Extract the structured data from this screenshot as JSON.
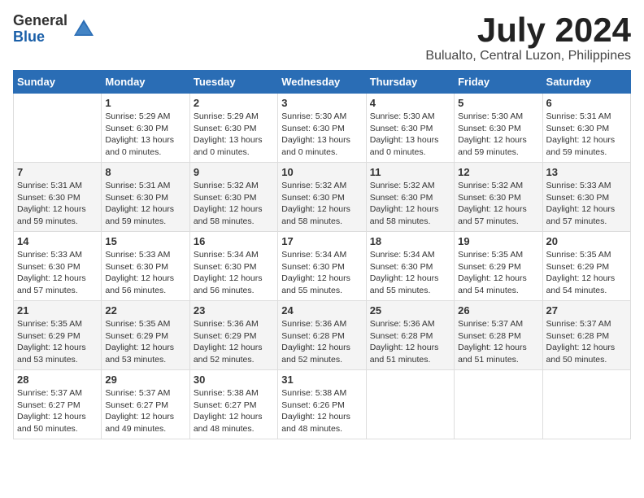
{
  "logo": {
    "general": "General",
    "blue": "Blue"
  },
  "title": "July 2024",
  "location": "Bulualto, Central Luzon, Philippines",
  "headers": [
    "Sunday",
    "Monday",
    "Tuesday",
    "Wednesday",
    "Thursday",
    "Friday",
    "Saturday"
  ],
  "weeks": [
    [
      {
        "day": "",
        "info": ""
      },
      {
        "day": "1",
        "info": "Sunrise: 5:29 AM\nSunset: 6:30 PM\nDaylight: 13 hours\nand 0 minutes."
      },
      {
        "day": "2",
        "info": "Sunrise: 5:29 AM\nSunset: 6:30 PM\nDaylight: 13 hours\nand 0 minutes."
      },
      {
        "day": "3",
        "info": "Sunrise: 5:30 AM\nSunset: 6:30 PM\nDaylight: 13 hours\nand 0 minutes."
      },
      {
        "day": "4",
        "info": "Sunrise: 5:30 AM\nSunset: 6:30 PM\nDaylight: 13 hours\nand 0 minutes."
      },
      {
        "day": "5",
        "info": "Sunrise: 5:30 AM\nSunset: 6:30 PM\nDaylight: 12 hours\nand 59 minutes."
      },
      {
        "day": "6",
        "info": "Sunrise: 5:31 AM\nSunset: 6:30 PM\nDaylight: 12 hours\nand 59 minutes."
      }
    ],
    [
      {
        "day": "7",
        "info": "Sunrise: 5:31 AM\nSunset: 6:30 PM\nDaylight: 12 hours\nand 59 minutes."
      },
      {
        "day": "8",
        "info": "Sunrise: 5:31 AM\nSunset: 6:30 PM\nDaylight: 12 hours\nand 59 minutes."
      },
      {
        "day": "9",
        "info": "Sunrise: 5:32 AM\nSunset: 6:30 PM\nDaylight: 12 hours\nand 58 minutes."
      },
      {
        "day": "10",
        "info": "Sunrise: 5:32 AM\nSunset: 6:30 PM\nDaylight: 12 hours\nand 58 minutes."
      },
      {
        "day": "11",
        "info": "Sunrise: 5:32 AM\nSunset: 6:30 PM\nDaylight: 12 hours\nand 58 minutes."
      },
      {
        "day": "12",
        "info": "Sunrise: 5:32 AM\nSunset: 6:30 PM\nDaylight: 12 hours\nand 57 minutes."
      },
      {
        "day": "13",
        "info": "Sunrise: 5:33 AM\nSunset: 6:30 PM\nDaylight: 12 hours\nand 57 minutes."
      }
    ],
    [
      {
        "day": "14",
        "info": "Sunrise: 5:33 AM\nSunset: 6:30 PM\nDaylight: 12 hours\nand 57 minutes."
      },
      {
        "day": "15",
        "info": "Sunrise: 5:33 AM\nSunset: 6:30 PM\nDaylight: 12 hours\nand 56 minutes."
      },
      {
        "day": "16",
        "info": "Sunrise: 5:34 AM\nSunset: 6:30 PM\nDaylight: 12 hours\nand 56 minutes."
      },
      {
        "day": "17",
        "info": "Sunrise: 5:34 AM\nSunset: 6:30 PM\nDaylight: 12 hours\nand 55 minutes."
      },
      {
        "day": "18",
        "info": "Sunrise: 5:34 AM\nSunset: 6:30 PM\nDaylight: 12 hours\nand 55 minutes."
      },
      {
        "day": "19",
        "info": "Sunrise: 5:35 AM\nSunset: 6:29 PM\nDaylight: 12 hours\nand 54 minutes."
      },
      {
        "day": "20",
        "info": "Sunrise: 5:35 AM\nSunset: 6:29 PM\nDaylight: 12 hours\nand 54 minutes."
      }
    ],
    [
      {
        "day": "21",
        "info": "Sunrise: 5:35 AM\nSunset: 6:29 PM\nDaylight: 12 hours\nand 53 minutes."
      },
      {
        "day": "22",
        "info": "Sunrise: 5:35 AM\nSunset: 6:29 PM\nDaylight: 12 hours\nand 53 minutes."
      },
      {
        "day": "23",
        "info": "Sunrise: 5:36 AM\nSunset: 6:29 PM\nDaylight: 12 hours\nand 52 minutes."
      },
      {
        "day": "24",
        "info": "Sunrise: 5:36 AM\nSunset: 6:28 PM\nDaylight: 12 hours\nand 52 minutes."
      },
      {
        "day": "25",
        "info": "Sunrise: 5:36 AM\nSunset: 6:28 PM\nDaylight: 12 hours\nand 51 minutes."
      },
      {
        "day": "26",
        "info": "Sunrise: 5:37 AM\nSunset: 6:28 PM\nDaylight: 12 hours\nand 51 minutes."
      },
      {
        "day": "27",
        "info": "Sunrise: 5:37 AM\nSunset: 6:28 PM\nDaylight: 12 hours\nand 50 minutes."
      }
    ],
    [
      {
        "day": "28",
        "info": "Sunrise: 5:37 AM\nSunset: 6:27 PM\nDaylight: 12 hours\nand 50 minutes."
      },
      {
        "day": "29",
        "info": "Sunrise: 5:37 AM\nSunset: 6:27 PM\nDaylight: 12 hours\nand 49 minutes."
      },
      {
        "day": "30",
        "info": "Sunrise: 5:38 AM\nSunset: 6:27 PM\nDaylight: 12 hours\nand 48 minutes."
      },
      {
        "day": "31",
        "info": "Sunrise: 5:38 AM\nSunset: 6:26 PM\nDaylight: 12 hours\nand 48 minutes."
      },
      {
        "day": "",
        "info": ""
      },
      {
        "day": "",
        "info": ""
      },
      {
        "day": "",
        "info": ""
      }
    ]
  ]
}
